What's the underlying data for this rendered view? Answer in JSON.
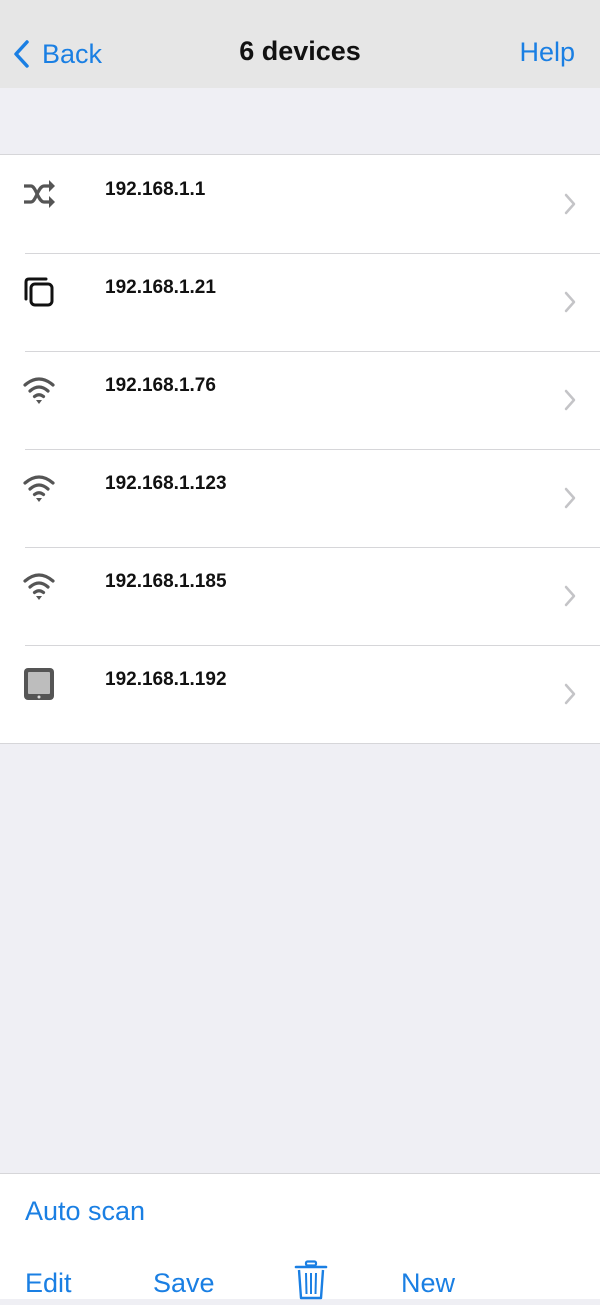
{
  "navbar": {
    "back_label": "Back",
    "title": "6 devices",
    "help_label": "Help",
    "back_icon": "chevron-left-icon"
  },
  "devices": [
    {
      "ip": "192.168.1.1",
      "icon": "shuffle-icon"
    },
    {
      "ip": "192.168.1.21",
      "icon": "copy-icon"
    },
    {
      "ip": "192.168.1.76",
      "icon": "wifi-icon"
    },
    {
      "ip": "192.168.1.123",
      "icon": "wifi-icon"
    },
    {
      "ip": "192.168.1.185",
      "icon": "wifi-icon"
    },
    {
      "ip": "192.168.1.192",
      "icon": "tablet-icon"
    }
  ],
  "toolbar": {
    "auto_scan_label": "Auto scan",
    "edit_label": "Edit",
    "save_label": "Save",
    "delete_icon": "trash-icon",
    "new_label": "New"
  },
  "colors": {
    "accent": "#1a7fe3",
    "background": "#efeff4",
    "navbar": "#e6e6e6",
    "icon": "#555555"
  }
}
